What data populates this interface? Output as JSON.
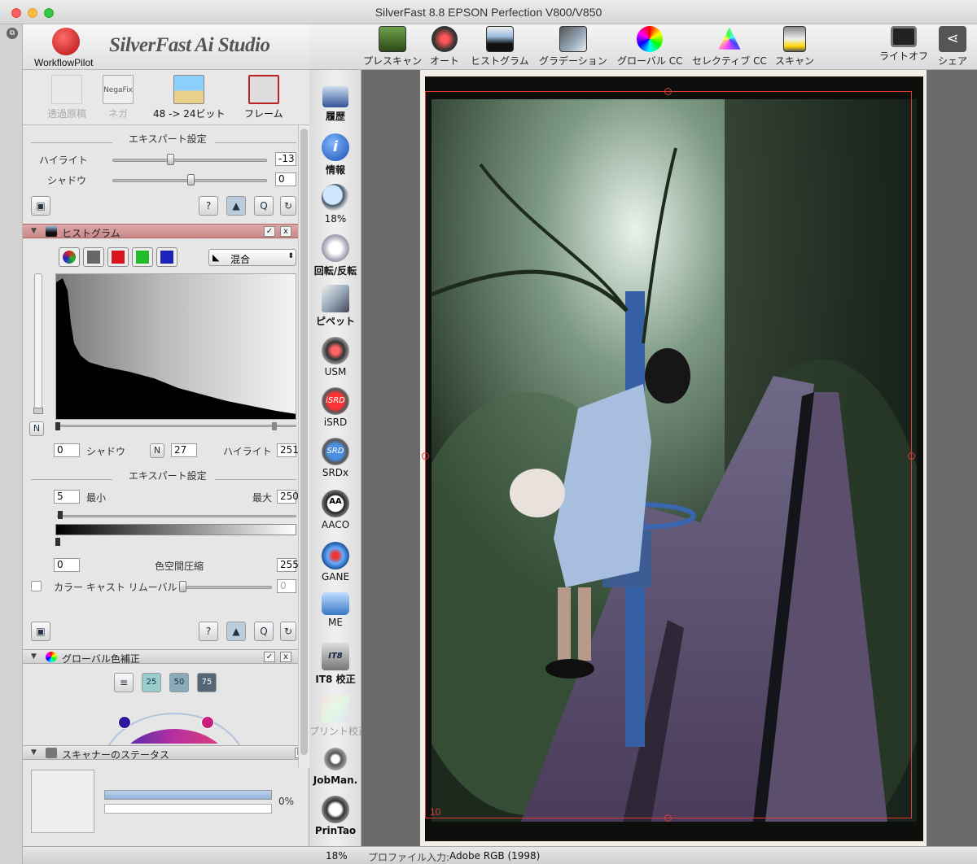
{
  "window": {
    "title": "SilverFast 8.8 EPSON Perfection V800/V850"
  },
  "brand": {
    "name": "SilverFast Ai Studio",
    "pilot_label": "WorkflowPilot"
  },
  "toolbar": {
    "items": [
      {
        "label": "プレスキャン",
        "icon": "prescan-icon"
      },
      {
        "label": "オート",
        "icon": "auto-icon"
      },
      {
        "label": "ヒストグラム",
        "icon": "histogram-icon"
      },
      {
        "label": "グラデーション",
        "icon": "gradation-icon"
      },
      {
        "label": "グローバル CC",
        "icon": "global-cc-icon"
      },
      {
        "label": "セレクティブ CC",
        "icon": "selective-cc-icon"
      },
      {
        "label": "スキャン",
        "icon": "scan-icon"
      },
      {
        "label": "ライトオフ",
        "icon": "lights-off-icon"
      },
      {
        "label": "シェア",
        "icon": "share-icon"
      }
    ]
  },
  "modes": {
    "transparency": "透過原稿",
    "negative": "ネガ",
    "negafix_badge": "NegaFix",
    "bitdepth": "48 -> 24ビット",
    "frame": "フレーム"
  },
  "expert1": {
    "title": "エキスパート設定",
    "highlight_label": "ハイライト",
    "highlight_value": "-13",
    "shadow_label": "シャドウ",
    "shadow_value": "0"
  },
  "histogram": {
    "title": "ヒストグラム",
    "mode": "混合",
    "shadow_value": "0",
    "shadow_label": "シャドウ",
    "neutral_btn": "N",
    "neutral_value": "27",
    "highlight_label": "ハイライト",
    "highlight_value": "251",
    "check": "✓",
    "close": "x",
    "colors": {
      "red": "#d9141c",
      "green": "#22bb2a",
      "blue": "#1c24b8"
    }
  },
  "expert2": {
    "title": "エキスパート設定",
    "min_value": "5",
    "min_label": "最小",
    "max_label": "最大",
    "max_value": "250",
    "compress_left": "0",
    "compress_label": "色空間圧縮",
    "compress_right": "255",
    "castremoval_label": "カラー キャスト リムーバル",
    "castremoval_value": "0"
  },
  "globalcc": {
    "title": "グローバル色補正",
    "check": "✓",
    "close": "x",
    "steps": [
      "25",
      "50",
      "75"
    ]
  },
  "scanner": {
    "title": "スキャナーのステータス",
    "progress_text": "0%",
    "progress": 0
  },
  "tools": [
    {
      "label": "履歴",
      "icon": "history-icon"
    },
    {
      "label": "情報",
      "icon": "info-icon"
    },
    {
      "label": "18%",
      "icon": "zoom-icon"
    },
    {
      "label": "回転/反転",
      "icon": "rotate-icon"
    },
    {
      "label": "ピペット",
      "icon": "pipette-icon"
    },
    {
      "label": "USM",
      "icon": "usm-icon"
    },
    {
      "label": "iSRD",
      "icon": "isrd-icon"
    },
    {
      "label": "SRDx",
      "icon": "srdx-icon"
    },
    {
      "label": "AACO",
      "icon": "aaco-icon"
    },
    {
      "label": "GANE",
      "icon": "gane-icon"
    },
    {
      "label": "ME",
      "icon": "me-icon"
    },
    {
      "label": "IT8 校正",
      "icon": "it8-icon"
    },
    {
      "label": "プリント校正",
      "icon": "print-proof-icon"
    },
    {
      "label": "JobMan.",
      "icon": "jobmanager-icon"
    },
    {
      "label": "PrinTao",
      "icon": "printao-icon"
    }
  ],
  "tool_badges": {
    "isrd": "iSRD",
    "srd": "SRD",
    "aa": "AA",
    "it8": "IT8"
  },
  "preview": {
    "frame_number": "10"
  },
  "status": {
    "zoom": "18%",
    "profile_label": "プロファイル入力:",
    "profile_value": "Adobe RGB (1998)"
  }
}
